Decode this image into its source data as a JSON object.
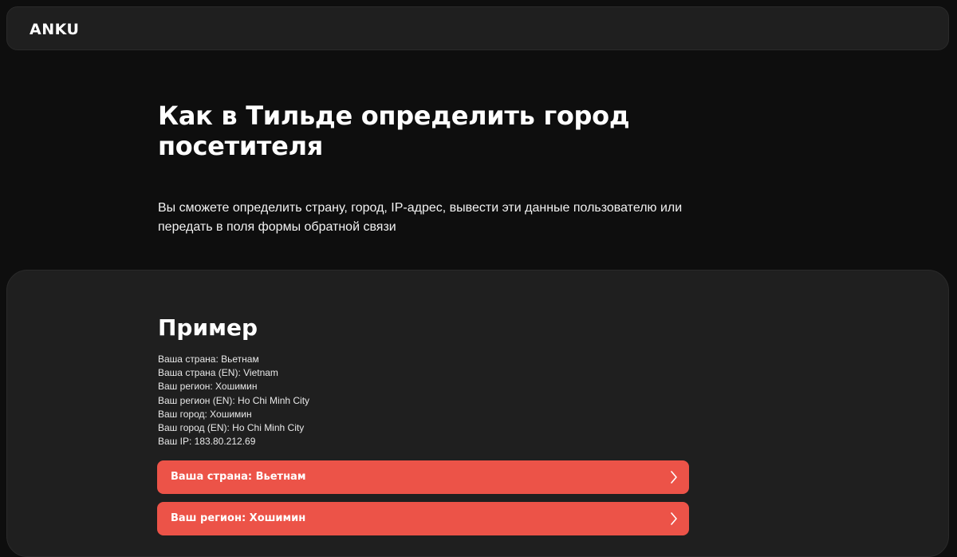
{
  "header": {
    "logo": "ANKU"
  },
  "hero": {
    "title": "Как в Тильде определить город посетителя",
    "description": "Вы сможете определить страну, город, IP-адрес, вывести эти данные пользователю или передать в поля формы обратной связи"
  },
  "example": {
    "title": "Пример",
    "lines": [
      "Ваша страна: Вьетнам",
      "Ваша страна (EN): Vietnam",
      "Ваш регион: Хошимин",
      "Ваш регион (EN): Ho Chi Minh City",
      "Ваш город: Хошимин",
      "Ваш город (EN): Ho Chi Minh City",
      "Ваш IP: 183.80.212.69"
    ],
    "buttons": [
      {
        "label": "Ваша страна: Вьетнам",
        "icon": "chevron-right-icon"
      },
      {
        "label": "Ваш регион: Хошимин",
        "icon": "chevron-right-icon"
      }
    ]
  },
  "colors": {
    "background": "#0e0e0e",
    "panel": "#1f1f1f",
    "accent": "#ec5348",
    "text": "#ffffff"
  }
}
